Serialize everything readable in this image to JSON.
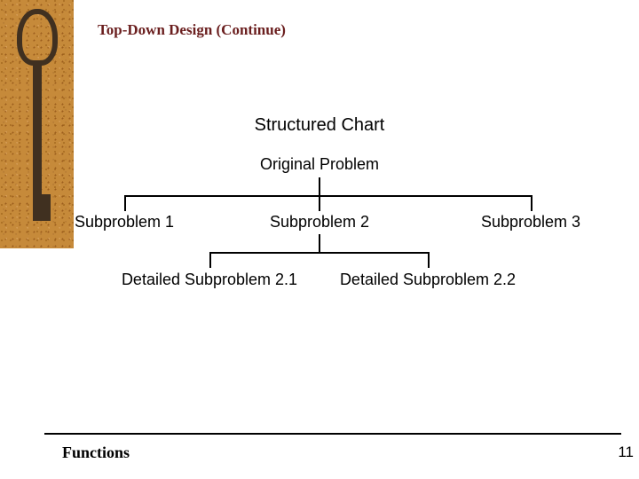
{
  "title": "Top-Down Design (Continue)",
  "chart_data": {
    "type": "tree",
    "title": "Structured Chart",
    "nodes": [
      {
        "id": "root",
        "label": "Original Problem",
        "parent": null
      },
      {
        "id": "s1",
        "label": "Subproblem 1",
        "parent": "root"
      },
      {
        "id": "s2",
        "label": "Subproblem 2",
        "parent": "root"
      },
      {
        "id": "s3",
        "label": "Subproblem 3",
        "parent": "root"
      },
      {
        "id": "d21",
        "label": "Detailed Subproblem 2.1",
        "parent": "s2"
      },
      {
        "id": "d22",
        "label": "Detailed Subproblem 2.2",
        "parent": "s2"
      }
    ]
  },
  "footer": {
    "section": "Functions",
    "page": "11"
  }
}
